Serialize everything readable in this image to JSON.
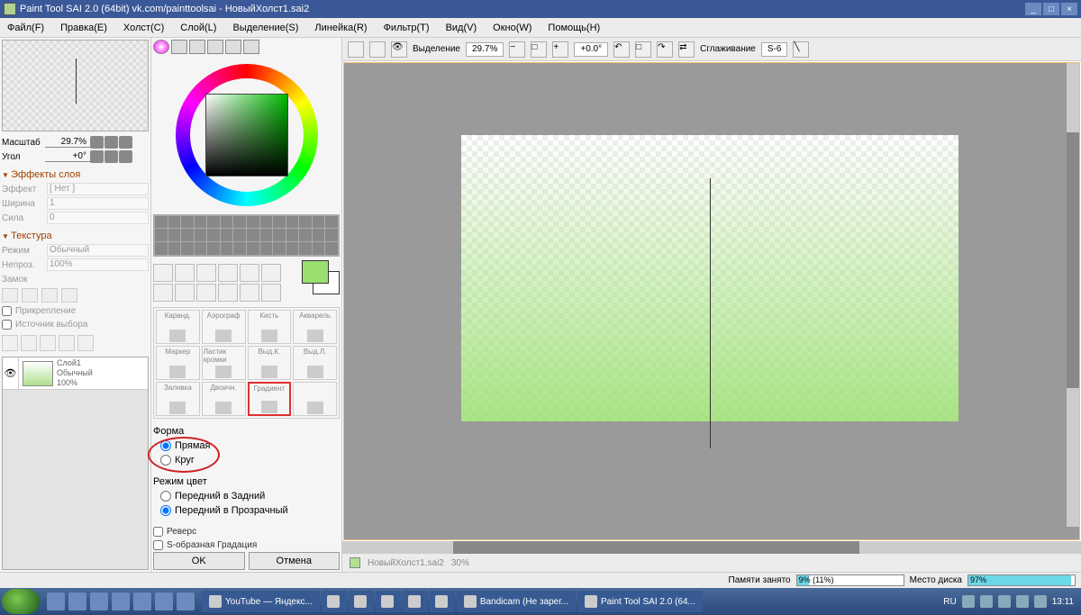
{
  "title": "Paint Tool SAI 2.0 (64bit) vk.com/painttoolsai - НовыйХолст1.sai2",
  "menu": [
    "Файл(F)",
    "Правка(E)",
    "Холст(C)",
    "Слой(L)",
    "Выделение(S)",
    "Линейка(R)",
    "Фильтр(T)",
    "Вид(V)",
    "Окно(W)",
    "Помощь(H)"
  ],
  "nav": {
    "scale_lbl": "Масштаб",
    "scale_val": "29.7%",
    "angle_lbl": "Угол",
    "angle_val": "+0°"
  },
  "effects": {
    "hdr": "Эффекты слоя",
    "effect_lbl": "Эффект",
    "effect_val": "[ Нет ]",
    "width_lbl": "Ширина",
    "width_val": "1",
    "strength_lbl": "Сила",
    "strength_val": "0"
  },
  "texture": {
    "hdr": "Текстура",
    "mode_lbl": "Режим",
    "mode_val": "Обычный",
    "opacity_lbl": "Непроз.",
    "opacity_val": "100%",
    "lock_lbl": "Замок",
    "pin_lbl": "Прикрепление",
    "src_lbl": "Источник выбора"
  },
  "layer": {
    "name": "Слой1",
    "mode": "Обычный",
    "opacity": "100%"
  },
  "brushes": [
    "Каранд.",
    "Аэрограф",
    "Кисть",
    "Акварель",
    "Маркер",
    "Ластик кромки",
    "Выд.К.",
    "Выд.Л.",
    "Заливка",
    "Двоичн.",
    "Градиент",
    ""
  ],
  "gradient": {
    "shape_hdr": "Форма",
    "shape_line": "Прямая",
    "shape_circle": "Круг",
    "color_hdr": "Режим цвет",
    "fg_bg": "Передний в Задний",
    "fg_tr": "Передний в Прозрачный",
    "reverse": "Реверс",
    "scurve": "S-образная Градация",
    "ok": "OK",
    "cancel": "Отмена"
  },
  "toolbar": {
    "select": "Выделение",
    "zoom": "29.7%",
    "angle": "+0.0°",
    "smooth_lbl": "Сглаживание",
    "smooth_val": "S-6"
  },
  "doc": {
    "name": "НовыйХолст1.sai2",
    "pct": "30%"
  },
  "status": {
    "mem_lbl": "Памяти занято",
    "mem_val": "9% (11%)",
    "mem_fill": 11,
    "disk_lbl": "Место диска",
    "disk_val": "97%",
    "disk_fill": 97
  },
  "taskbar": {
    "tasks": [
      "YouTube — Яндекс...",
      "",
      "",
      "",
      "",
      "Bandicam (Не зарег...",
      "Paint Tool SAI 2.0 (64..."
    ],
    "lang": "RU",
    "time": "13:11"
  }
}
